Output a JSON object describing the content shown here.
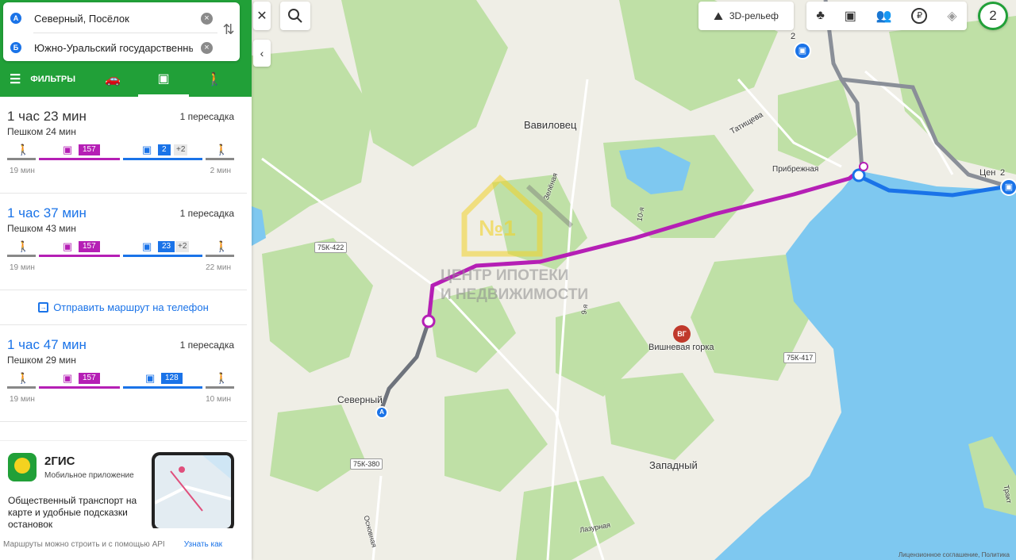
{
  "search": {
    "from_marker": "A",
    "from_value": "Северный, Посёлок",
    "to_marker": "Б",
    "to_value": "Южно-Уральский государственны"
  },
  "tabs": {
    "filters_label": "ФИЛЬТРЫ"
  },
  "routes": [
    {
      "time": "1 час 23 мин",
      "transfers": "1 пересадка",
      "walk": "Пешком 24 мин",
      "first_walk_min": "19 мин",
      "last_walk_min": "2 мин",
      "seg1_badge": "157",
      "seg2_badge": "2",
      "seg2_extra": "+2"
    },
    {
      "time": "1 час 37 мин",
      "transfers": "1 пересадка",
      "walk": "Пешком 43 мин",
      "first_walk_min": "19 мин",
      "last_walk_min": "22 мин",
      "seg1_badge": "157",
      "seg2_badge": "23",
      "seg2_extra": "+2"
    },
    {
      "time": "1 час 47 мин",
      "transfers": "1 пересадка",
      "walk": "Пешком 29 мин",
      "first_walk_min": "19 мин",
      "last_walk_min": "10 мин",
      "seg1_badge": "157",
      "seg2_badge": "128",
      "seg2_extra": ""
    }
  ],
  "send_to_phone": "Отправить маршрут на телефон",
  "promo": {
    "brand": "2ГИС",
    "subtitle": "Мобильное приложение",
    "description": "Общественный транспорт на карте и удобные подсказки остановок"
  },
  "footer": {
    "text": "Маршруты можно строить и с помощью API",
    "link": "Узнать как"
  },
  "map": {
    "relief_label": "3D-рельеф",
    "zoom_badge": "2",
    "labels": {
      "vavilovets": "Вавиловец",
      "severny": "Северный",
      "zapadny": "Западный",
      "vishnevaya": "Вишневая горка",
      "pribrezhnaya": "Прибрежная",
      "tatishcheva": "Татищева",
      "zelenaya": "Зелёная",
      "lazurnaya": "Лазурная",
      "osnovnaya": "Основная",
      "tenth": "10-я",
      "ninth": "9-я",
      "tsen": "Цен",
      "trakt": "Тракт"
    },
    "roads": {
      "r1": "75К-422",
      "r2": "75К-380",
      "r3": "75К-417"
    },
    "poi_badge": "ВГ",
    "watermark_line1": "ЦЕНТР ИПОТЕКИ",
    "watermark_line2": "И НЕДВИЖИМОСТИ",
    "watermark_mark": "№1",
    "stop_number_1": "2",
    "stop_number_2": "2",
    "copyright": "Лицензионное соглашение, Политика"
  },
  "colors": {
    "brand_green": "#21a038",
    "route_magenta": "#b51fb5",
    "route_blue": "#1a73e8",
    "water": "#7ec8f0",
    "forest": "#b8dca0"
  }
}
